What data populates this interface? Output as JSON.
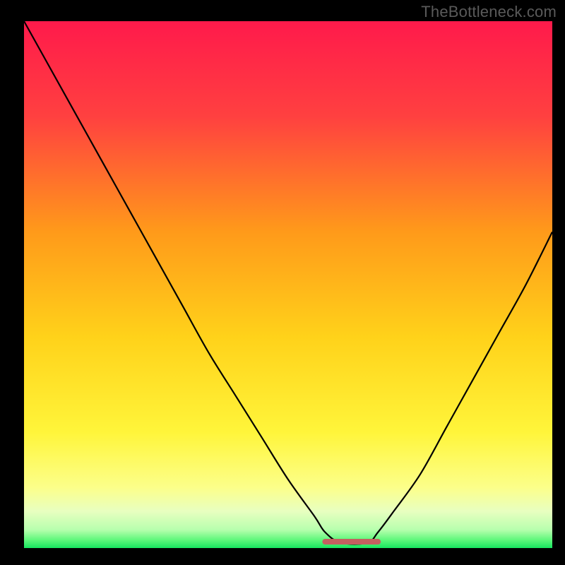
{
  "watermark": "TheBottleneck.com",
  "colors": {
    "frame": "#000000",
    "curve": "#000000",
    "flat_marker": "#c46060",
    "gradient_stops": [
      {
        "offset": 0.0,
        "color": "#ff1a4b"
      },
      {
        "offset": 0.18,
        "color": "#ff4040"
      },
      {
        "offset": 0.4,
        "color": "#ff9a1a"
      },
      {
        "offset": 0.6,
        "color": "#ffd21a"
      },
      {
        "offset": 0.78,
        "color": "#fff53a"
      },
      {
        "offset": 0.885,
        "color": "#fcff8a"
      },
      {
        "offset": 0.93,
        "color": "#e8ffc0"
      },
      {
        "offset": 0.965,
        "color": "#b8ffae"
      },
      {
        "offset": 0.985,
        "color": "#5cf77a"
      },
      {
        "offset": 1.0,
        "color": "#17e55f"
      }
    ]
  },
  "chart_data": {
    "type": "line",
    "title": "",
    "xlabel": "",
    "ylabel": "",
    "xlim": [
      0,
      100
    ],
    "ylim": [
      0,
      100
    ],
    "x": [
      0,
      5,
      10,
      15,
      20,
      25,
      30,
      35,
      40,
      45,
      50,
      55,
      57,
      60,
      65,
      67,
      70,
      75,
      80,
      85,
      90,
      95,
      100
    ],
    "y": [
      100,
      91,
      82,
      73,
      64,
      55,
      46,
      37,
      29,
      21,
      13,
      6,
      3,
      1,
      1,
      3,
      7,
      14,
      23,
      32,
      41,
      50,
      60
    ],
    "flat_region": {
      "x_start": 57,
      "x_end": 67,
      "y": 1.2
    },
    "notes": "Bottleneck-style curve: steep descent from x=0 to a minimum near x≈62, then rises again. Background is a vertical red→orange→yellow→green gradient (match % / severity). Values estimated from pixels; no explicit axes or tick labels are rendered."
  }
}
